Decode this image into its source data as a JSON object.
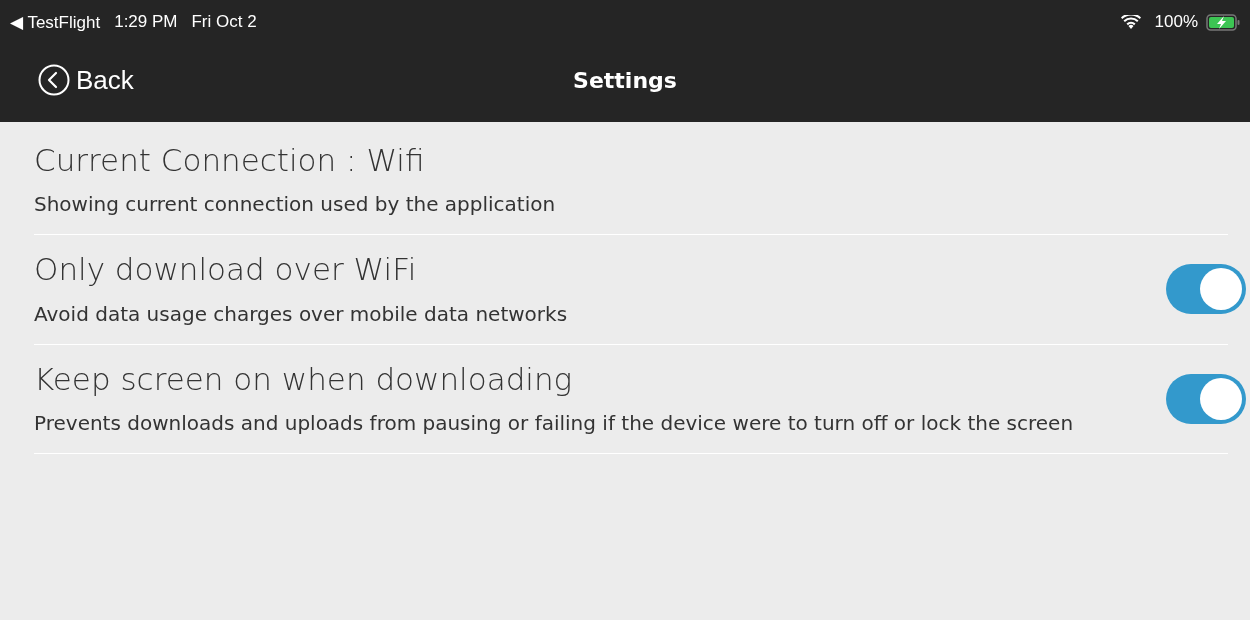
{
  "status_bar": {
    "back_app": "◀ TestFlight",
    "time": "1:29 PM",
    "date": "Fri Oct 2",
    "battery": "100%"
  },
  "nav": {
    "back": "Back",
    "title": "Settings"
  },
  "settings": [
    {
      "kind": "info",
      "title": "Current Connection : Wifi",
      "description": "Showing current connection used by the application"
    },
    {
      "kind": "toggle",
      "title": "Only download over WiFi",
      "description": "Avoid data usage charges over mobile data networks",
      "on": true
    },
    {
      "kind": "toggle",
      "title": "Keep screen on when downloading",
      "description": "Prevents downloads and uploads from pausing or failing if the device were to turn off or lock the screen",
      "on": true
    }
  ]
}
